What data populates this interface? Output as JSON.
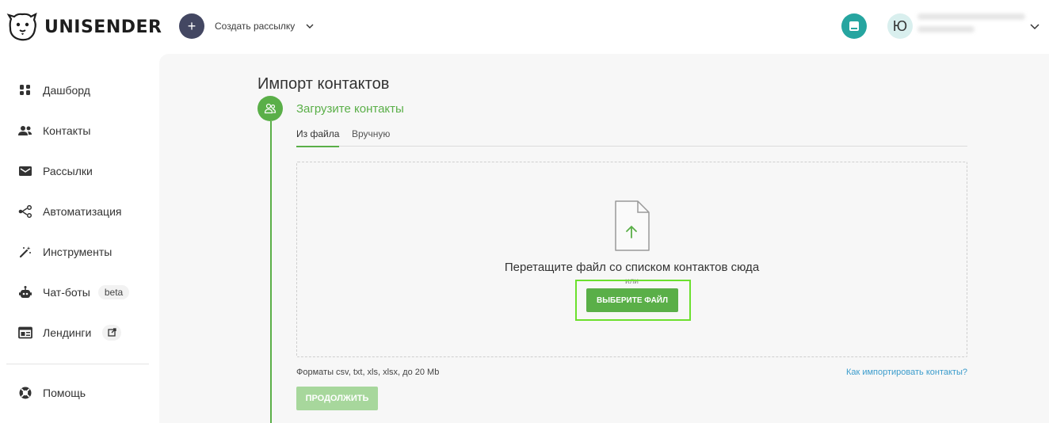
{
  "brand": {
    "name": "UNISENDER",
    "accent": "#5aaf48"
  },
  "header": {
    "create_label": "Создать рассылку",
    "avatar_initial": "Ю"
  },
  "sidebar": {
    "items": [
      {
        "label": "Дашборд",
        "icon": "dashboard-icon"
      },
      {
        "label": "Контакты",
        "icon": "contacts-icon"
      },
      {
        "label": "Рассылки",
        "icon": "mail-icon"
      },
      {
        "label": "Автоматизация",
        "icon": "automation-icon"
      },
      {
        "label": "Инструменты",
        "icon": "magic-wand-icon"
      },
      {
        "label": "Чат-боты",
        "icon": "robot-icon",
        "badge": "beta"
      },
      {
        "label": "Лендинги",
        "icon": "landing-icon"
      }
    ],
    "help_label": "Помощь"
  },
  "main": {
    "title": "Импорт контактов",
    "step_title": "Загрузите контакты",
    "tabs": [
      {
        "label": "Из файла",
        "active": true
      },
      {
        "label": "Вручную",
        "active": false
      }
    ],
    "drop_text": "Перетащите файл со списком контактов сюда",
    "or_text": "или",
    "choose_file_label": "ВЫБЕРИТЕ ФАЙЛ",
    "formats_text": "Форматы csv, txt, xls, xlsx, до 20 Mb",
    "how_to_link": "Как импортировать контакты?",
    "continue_label": "ПРОДОЛЖИТЬ"
  }
}
